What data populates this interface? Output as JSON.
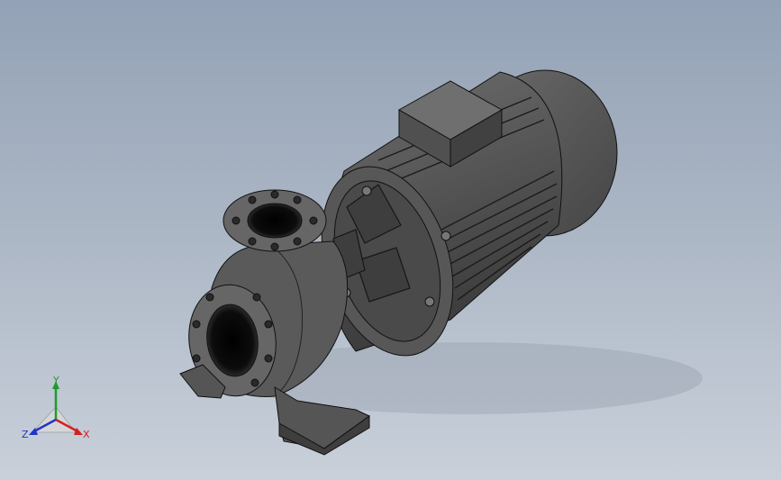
{
  "viewport": {
    "background_top": "#93a2b6",
    "background_bottom": "#c9d0da",
    "part_color": "#5b5b5b",
    "part_dark": "#3a3a3a",
    "part_light": "#7a7a7a",
    "edge_color": "#111111"
  },
  "model": {
    "name": "centrifugal-pump-with-motor",
    "components": [
      "motor",
      "terminal-box",
      "pump-volute",
      "suction-flange",
      "discharge-flange",
      "mounting-feet"
    ]
  },
  "triad": {
    "x_label": "X",
    "y_label": "Y",
    "z_label": "Z",
    "x_color": "#d42020",
    "y_color": "#1f9a2e",
    "z_color": "#2136c8"
  }
}
